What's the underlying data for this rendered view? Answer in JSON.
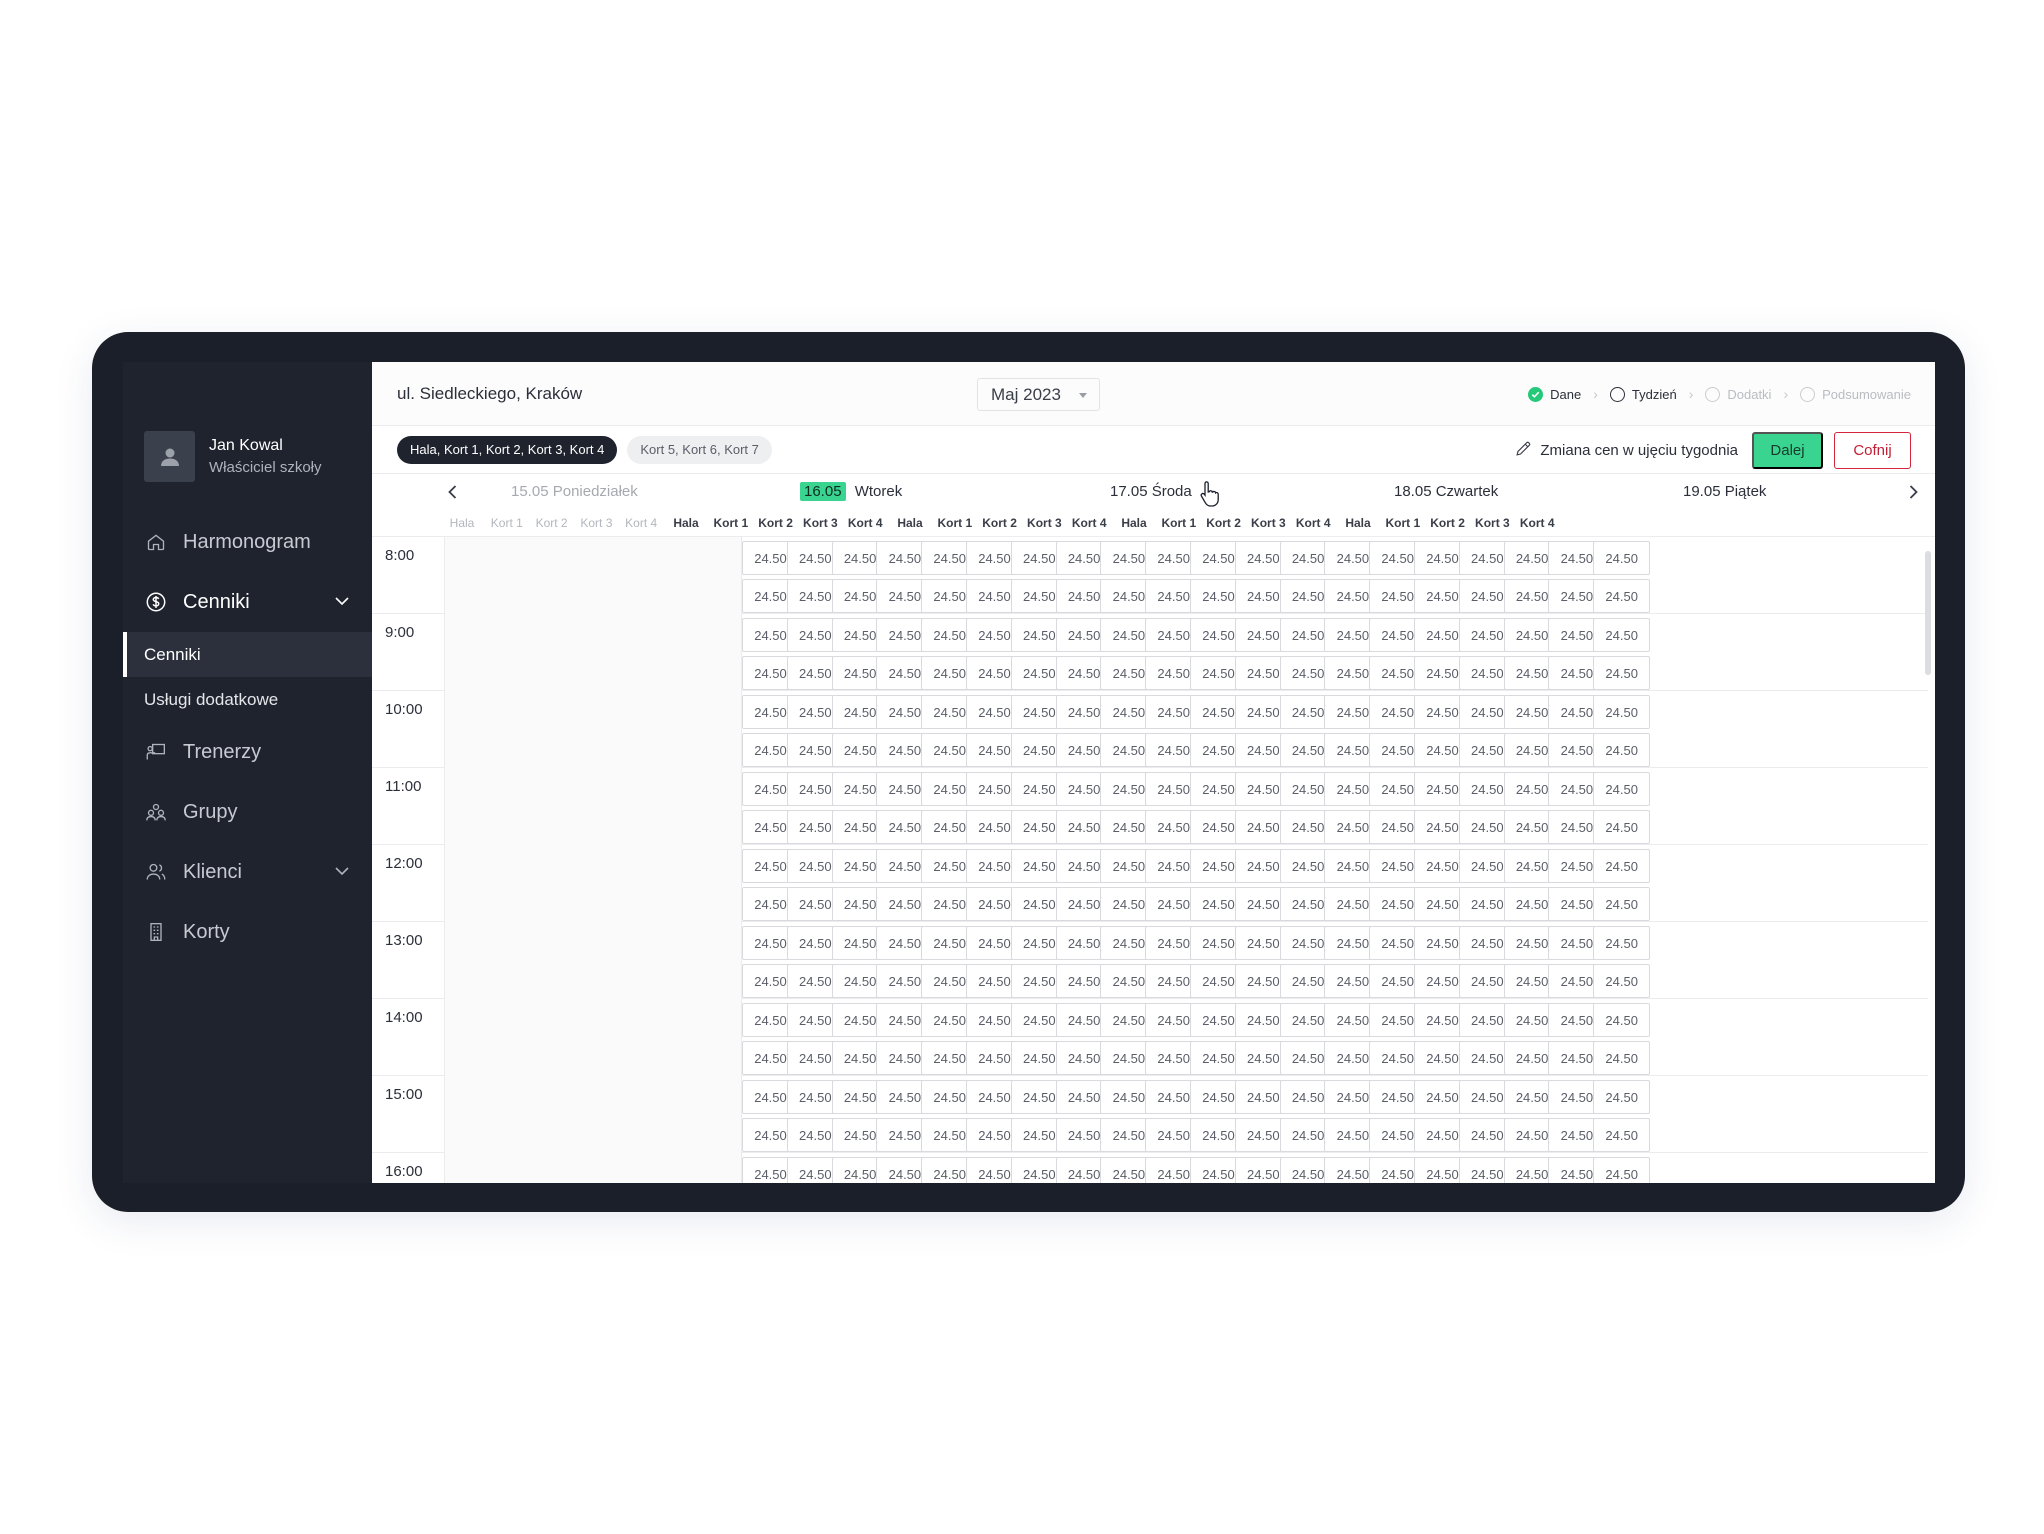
{
  "sidebar": {
    "user": {
      "name": "Jan Kowal",
      "role": "Właściciel szkoły"
    },
    "nav": [
      {
        "label": "Harmonogram",
        "icon": "home-icon"
      },
      {
        "label": "Cenniki",
        "icon": "dollar-circle-icon",
        "expanded": true,
        "children": [
          {
            "label": "Cenniki",
            "active": true
          },
          {
            "label": "Usługi dodatkowe"
          }
        ]
      },
      {
        "label": "Trenerzy",
        "icon": "trainer-board-icon"
      },
      {
        "label": "Grupy",
        "icon": "group-icon"
      },
      {
        "label": "Klienci",
        "icon": "users-icon",
        "expandable": true
      },
      {
        "label": "Korty",
        "icon": "building-icon"
      }
    ]
  },
  "topbar": {
    "location": "ul. Siedleckiego, Kraków",
    "month": "Maj 2023",
    "steps": [
      {
        "label": "Dane",
        "state": "done"
      },
      {
        "label": "Tydzień",
        "state": "current"
      },
      {
        "label": "Dodatki",
        "state": "pending"
      },
      {
        "label": "Podsumowanie",
        "state": "pending"
      }
    ]
  },
  "toolbar": {
    "chips": [
      "Hala, Kort 1, Kort 2, Kort 3, Kort 4",
      "Kort 5, Kort 6, Kort 7"
    ],
    "edit_label": "Zmiana cen w ujęciu tygodnia",
    "next_label": "Dalej",
    "back_label": "Cofnij"
  },
  "calendar": {
    "days": [
      {
        "date": "15.05",
        "name": "Poniedziałek",
        "past": true
      },
      {
        "date": "16.05",
        "name": "Wtorek",
        "today": true
      },
      {
        "date": "17.05",
        "name": "Środa"
      },
      {
        "date": "18.05",
        "name": "Czwartek"
      },
      {
        "date": "19.05",
        "name": "Piątek"
      }
    ],
    "courts": [
      "Hala",
      "Kort 1",
      "Kort 2",
      "Kort 3",
      "Kort 4"
    ],
    "hours": [
      "8:00",
      "9:00",
      "10:00",
      "11:00",
      "12:00",
      "13:00",
      "14:00",
      "15:00",
      "16:00"
    ],
    "price": "24.50"
  },
  "colors": {
    "accent": "#3ad491",
    "sidebar": "#1f232e",
    "danger": "#d1263b"
  }
}
